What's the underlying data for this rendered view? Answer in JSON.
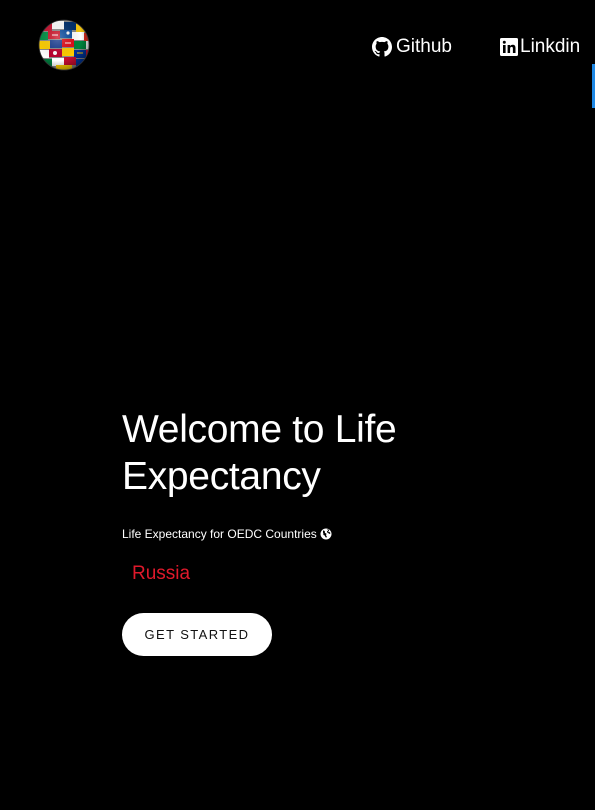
{
  "header": {
    "logo_icon": "world-flags-globe-icon",
    "nav": [
      {
        "label": "Github",
        "icon": "github-icon"
      },
      {
        "label": "Linkdin",
        "icon": "linkedin-icon"
      }
    ]
  },
  "hero": {
    "title": "Welcome to Life Expectancy",
    "subtitle": "Life Expectancy for OEDC Countries",
    "subtitle_icon": "globe-icon",
    "country": "Russia",
    "cta_label": "GET STARTED"
  },
  "colors": {
    "background": "#000000",
    "text": "#ffffff",
    "country_accent": "#e0192b",
    "button_background": "#ffffff",
    "edge_bar": "#1e88e5"
  }
}
